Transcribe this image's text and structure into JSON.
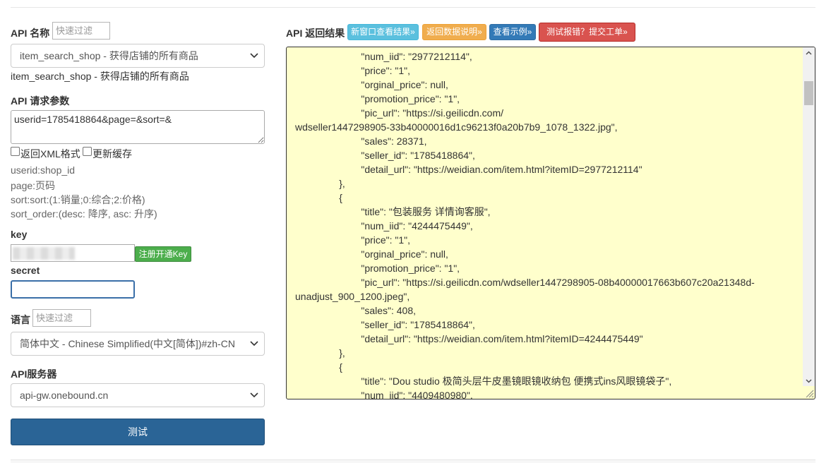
{
  "api_name": {
    "label": "API 名称",
    "filter_placeholder": "快速过滤",
    "selected": "item_search_shop - 获得店铺的所有商品",
    "description": "item_search_shop - 获得店铺的所有商品"
  },
  "params": {
    "label": "API 请求参数",
    "value": "userid=1785418864&page=&sort=&",
    "xml_checkbox_label": "返回XML格式",
    "cache_checkbox_label": "更新缓存",
    "hints": [
      "userid:shop_id",
      "page:页码",
      "sort:sort:(1:销量;0:综合;2:价格)",
      "sort_order:(desc: 降序, asc: 升序)"
    ]
  },
  "key": {
    "label": "key",
    "register_button": "注册开通Key"
  },
  "secret": {
    "label": "secret"
  },
  "language": {
    "label": "语言",
    "filter_placeholder": "快速过滤",
    "selected": "简体中文 - Chinese Simplified(中文[简体])#zh-CN"
  },
  "server": {
    "label": "API服务器",
    "selected": "api-gw.onebound.cn"
  },
  "test_button": "测试",
  "result": {
    "label": "API 返回结果",
    "buttons": [
      "新窗口查看结果»",
      "返回数据说明»",
      "查看示例»",
      "测试报错？提交工单»"
    ],
    "lines": [
      "                        \"num_iid\": \"2977212114\",",
      "                        \"price\": \"1\",",
      "                        \"orginal_price\": null,",
      "                        \"promotion_price\": \"1\",",
      "                        \"pic_url\": \"https://si.geilicdn.com/",
      "wdseller1447298905-33b40000016d1c96213f0a20b7b9_1078_1322.jpg\",",
      "                        \"sales\": 28371,",
      "                        \"seller_id\": \"1785418864\",",
      "                        \"detail_url\": \"https://weidian.com/item.html?itemID=2977212114\"",
      "                },",
      "                {",
      "                        \"title\": \"包装服务 详情询客服\",",
      "                        \"num_iid\": \"4244475449\",",
      "                        \"price\": \"1\",",
      "                        \"orginal_price\": null,",
      "                        \"promotion_price\": \"1\",",
      "                        \"pic_url\": \"https://si.geilicdn.com/wdseller1447298905-08b40000017663b607c20a21348d-",
      "unadjust_900_1200.jpeg\",",
      "                        \"sales\": 408,",
      "                        \"seller_id\": \"1785418864\",",
      "                        \"detail_url\": \"https://weidian.com/item.html?itemID=4244475449\"",
      "                },",
      "                {",
      "                        \"title\": \"Dou studio 极简头层牛皮墨镜眼镜收纳包 便携式ins风眼镜袋子\",",
      "                        \"num_iid\": \"4409480980\","
    ]
  },
  "colors": {
    "result_bg": "#ffffcc",
    "test_button": "#2a6496",
    "register_button": "#4cae4c"
  }
}
